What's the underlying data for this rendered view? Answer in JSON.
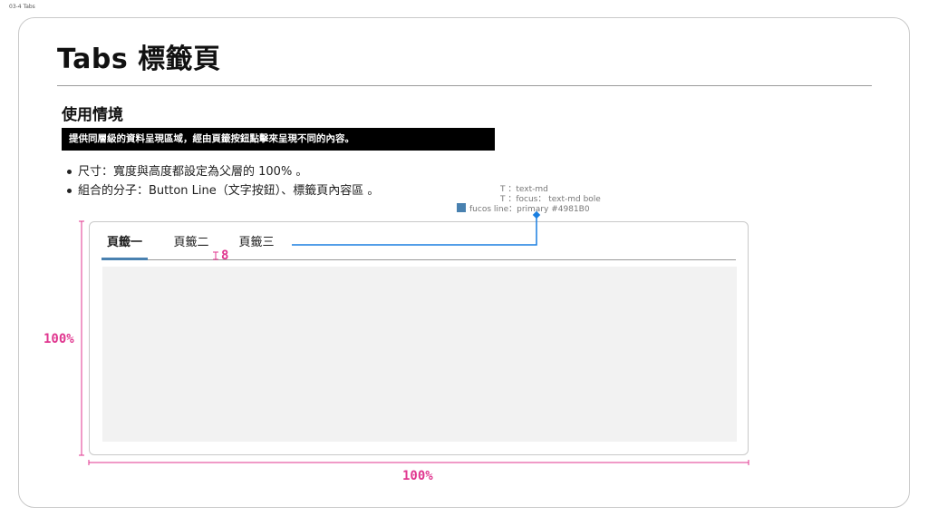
{
  "page_label": "03-4 Tabs",
  "title": "Tabs 標籤頁",
  "section_title": "使用情境",
  "banner_text": "提供同層級的資料呈現區域，經由頁籤按鈕點擊來呈現不同的內容。",
  "bullets": [
    "尺寸：寬度與高度都設定為父層的 100% 。",
    "組合的分子：Button Line（文字按鈕）、標籤頁內容區 。"
  ],
  "annotations": {
    "line1": "T ：text-md",
    "line2": "T ：focus： text-md bole",
    "line3": "fucos line：primary #4981B0"
  },
  "tabs": [
    {
      "label": "頁籤一",
      "active": true
    },
    {
      "label": "頁籤二",
      "active": false
    },
    {
      "label": "頁籤三",
      "active": false
    }
  ],
  "measurements": {
    "gap": "8",
    "height": "100%",
    "width": "100%"
  },
  "colors": {
    "primary": "#4981B0",
    "measure": "#e0368f",
    "callout": "#1a7fe0"
  }
}
